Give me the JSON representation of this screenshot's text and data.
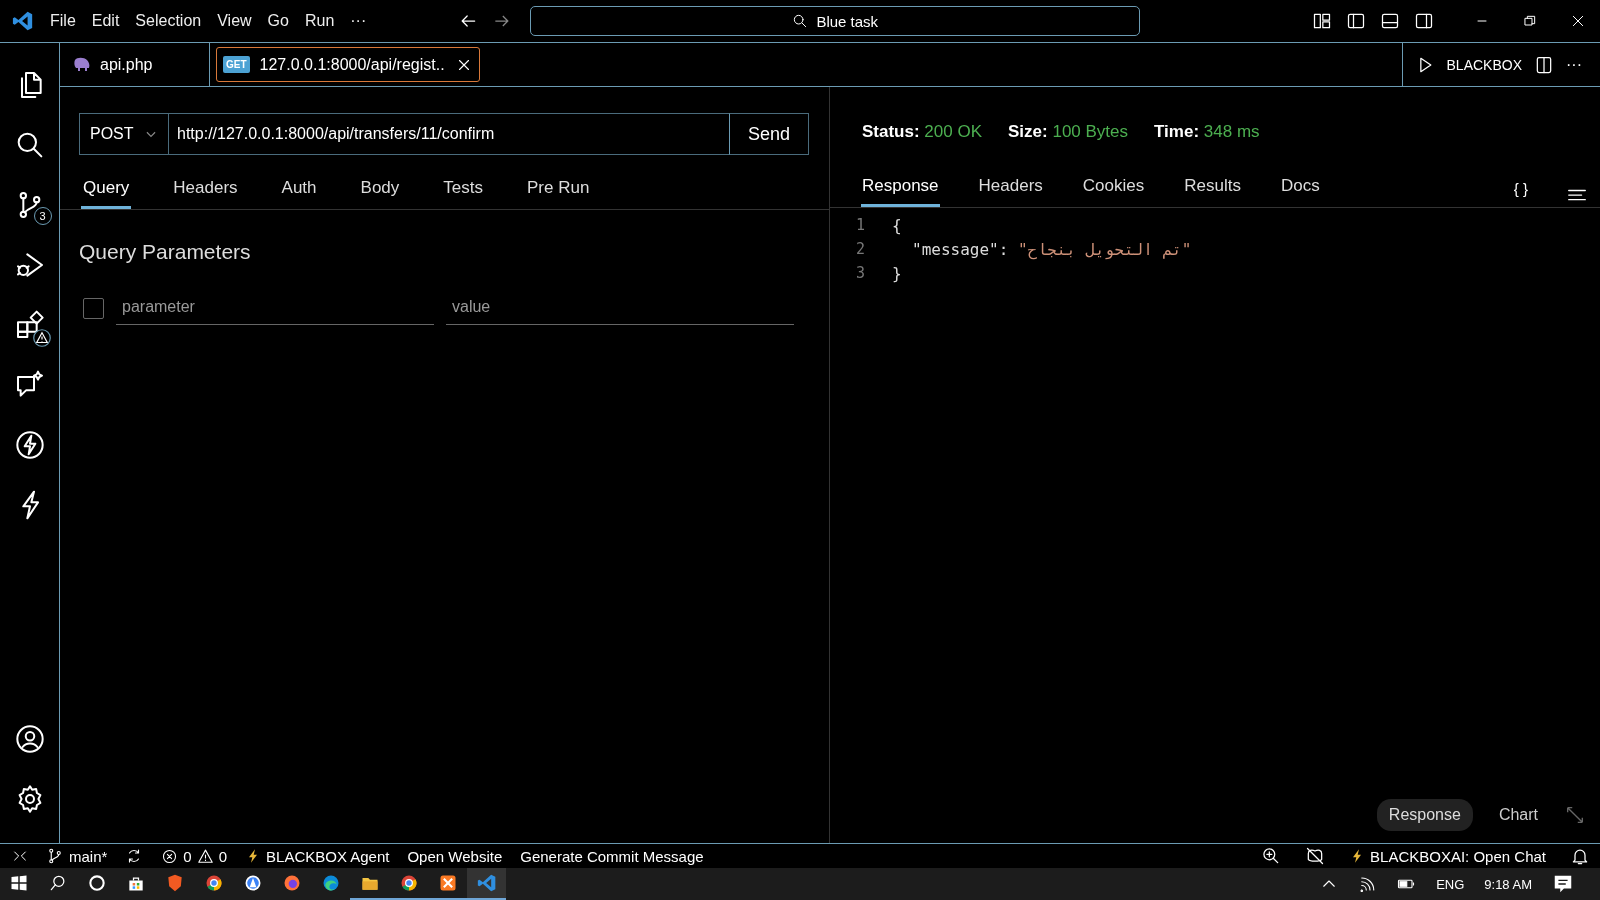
{
  "title_bar": {
    "menu": [
      "File",
      "Edit",
      "Selection",
      "View",
      "Go",
      "Run",
      "···"
    ],
    "search": "Blue task"
  },
  "activity_bar": {
    "top": [
      {
        "kind": "files"
      },
      {
        "kind": "search"
      },
      {
        "kind": "source-control",
        "badge": "3"
      },
      {
        "kind": "run-debug"
      },
      {
        "kind": "extensions"
      },
      {
        "kind": "chat"
      },
      {
        "kind": "bolt-circle"
      },
      {
        "kind": "bolt"
      }
    ],
    "bottom": [
      {
        "kind": "account"
      },
      {
        "kind": "settings"
      }
    ]
  },
  "editor_tabs": [
    {
      "label": "api.php",
      "kind": "php",
      "selected": false
    },
    {
      "label": "127.0.0.1:8000/api/regist..",
      "kind": "request",
      "badge": "GET",
      "selected": true
    }
  ],
  "editor_actions": {
    "label": "BLACKBOX",
    "more": "···"
  },
  "request": {
    "method": "POST",
    "url": "http://127.0.0.1:8000/api/transfers/11/confirm",
    "send": "Send",
    "tabs": [
      {
        "label": "Query",
        "selected": true
      },
      {
        "label": "Headers",
        "selected": false
      },
      {
        "label": "Auth",
        "selected": false
      },
      {
        "label": "Body",
        "selected": false
      },
      {
        "label": "Tests",
        "selected": false
      },
      {
        "label": "Pre Run",
        "selected": false
      }
    ],
    "section_title": "Query Parameters",
    "params": [
      {
        "checked": false,
        "key_placeholder": "parameter",
        "value_placeholder": "value"
      }
    ]
  },
  "response": {
    "stats": [
      {
        "label": "Status:",
        "value": "200 OK"
      },
      {
        "label": "Size:",
        "value": "100 Bytes"
      },
      {
        "label": "Time:",
        "value": "348 ms"
      }
    ],
    "tabs": [
      {
        "label": "Response",
        "selected": true
      },
      {
        "label": "Headers",
        "selected": false
      },
      {
        "label": "Cookies",
        "selected": false
      },
      {
        "label": "Results",
        "selected": false
      },
      {
        "label": "Docs",
        "selected": false
      }
    ],
    "format_button": "{ }",
    "lines": [
      {
        "number": "1",
        "parts": [
          {
            "kind": "punct",
            "text": "{"
          }
        ]
      },
      {
        "number": "2",
        "parts": [
          {
            "kind": "key",
            "text": "\"message\""
          },
          {
            "kind": "punct",
            "text": ":"
          },
          {
            "kind": "string",
            "text": "\"تم التحويل بنجاح\""
          }
        ]
      },
      {
        "number": "3",
        "parts": [
          {
            "kind": "punct",
            "text": "}"
          }
        ]
      }
    ],
    "view_toggle": [
      {
        "label": "Response",
        "selected": true
      },
      {
        "label": "Chart",
        "selected": false
      }
    ]
  },
  "status_bar": {
    "branch": "main*",
    "errors": "0",
    "warnings": "0",
    "left_items": [
      {
        "kind": "bolt",
        "label": "BLACKBOX Agent"
      },
      {
        "kind": "plain",
        "label": "Open Website"
      },
      {
        "kind": "plain",
        "label": "Generate Commit Message"
      }
    ],
    "right_item": "BLACKBOXAI: Open Chat"
  },
  "taskbar": {
    "apps": [
      {
        "kind": "store",
        "running": false,
        "selected": false
      },
      {
        "kind": "brave",
        "running": false,
        "selected": false
      },
      {
        "kind": "chrome",
        "running": false,
        "selected": false
      },
      {
        "kind": "appstore",
        "running": false,
        "selected": false
      },
      {
        "kind": "firefox",
        "running": false,
        "selected": false
      },
      {
        "kind": "edge",
        "running": false,
        "selected": false
      },
      {
        "kind": "explorer",
        "running": true,
        "selected": false
      },
      {
        "kind": "chrome",
        "running": true,
        "selected": false
      },
      {
        "kind": "xampp",
        "running": true,
        "selected": false
      },
      {
        "kind": "vscode",
        "running": true,
        "selected": true
      }
    ],
    "language": "ENG",
    "time": "9:18 AM"
  }
}
